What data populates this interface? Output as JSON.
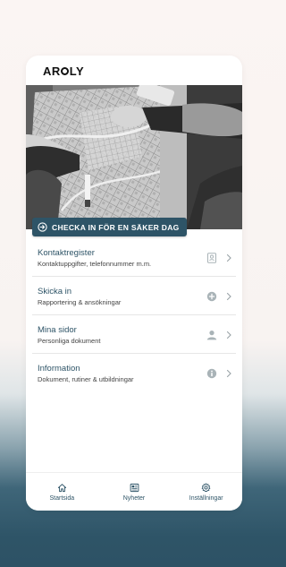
{
  "app": {
    "logo": {
      "pre": "AR",
      "post": "LY"
    }
  },
  "hero": {
    "checkin_label": "CHECKA IN FÖR EN SÄKER DAG",
    "checkin_icon": "arrow-circle-right-icon"
  },
  "menu": {
    "items": [
      {
        "title": "Kontaktregister",
        "subtitle": "Kontaktuppgifter, telefonnummer m.m.",
        "icon": "contact-card-icon"
      },
      {
        "title": "Skicka in",
        "subtitle": "Rapportering & ansökningar",
        "icon": "plus-circle-icon"
      },
      {
        "title": "Mina sidor",
        "subtitle": "Personliga dokument",
        "icon": "person-icon"
      },
      {
        "title": "Information",
        "subtitle": "Dokument, rutiner & utbildningar",
        "icon": "info-circle-icon"
      }
    ]
  },
  "tabbar": {
    "tabs": [
      {
        "label": "Startsida",
        "icon": "home-icon"
      },
      {
        "label": "Nyheter",
        "icon": "newspaper-icon"
      },
      {
        "label": "Inställningar",
        "icon": "gear-icon"
      }
    ]
  },
  "colors": {
    "accent": "#2e5467",
    "muted_icon": "#a9b3b7"
  }
}
